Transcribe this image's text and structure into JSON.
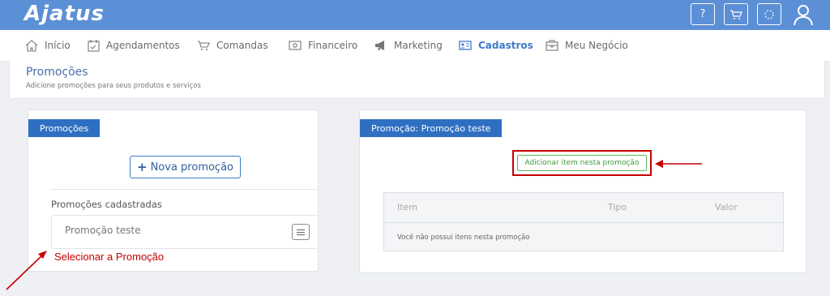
{
  "app": {
    "logo": "Ajatus",
    "top_buttons": [
      {
        "name": "help-button",
        "label": "?"
      }
    ]
  },
  "nav": {
    "items": [
      {
        "label": "Início",
        "icon": "home-icon"
      },
      {
        "label": "Agendamentos",
        "icon": "calendar-icon"
      },
      {
        "label": "Comandas",
        "icon": "cart-icon"
      },
      {
        "label": "Financeiro",
        "icon": "money-icon"
      },
      {
        "label": "Marketing",
        "icon": "megaphone-icon"
      },
      {
        "label": "Cadastros",
        "icon": "id-card-icon",
        "active": true
      },
      {
        "label": "Meu Negócio",
        "icon": "briefcase-icon"
      }
    ]
  },
  "page": {
    "title": "Promoções",
    "subtitle": "Adicione promoções para seus produtos e serviços"
  },
  "left_card": {
    "tab": "Promoções",
    "new_button": "Nova promoção",
    "list_label": "Promoções cadastradas",
    "items": [
      "Promoção teste"
    ]
  },
  "right_card": {
    "tab": "Promoção: Promoção teste",
    "add_button": "Adicionar item nesta promoção",
    "table": {
      "headers": [
        "Item",
        "Tipo",
        "Valor"
      ],
      "empty_message": "Você não possui itens nesta promoção"
    }
  },
  "annotation": {
    "label": "Selecionar a Promoção"
  },
  "colors": {
    "topbar": "#5b8fd6",
    "accent": "#2f6fc2",
    "annotation": "#c40000",
    "add_button": "#5cb85c"
  }
}
